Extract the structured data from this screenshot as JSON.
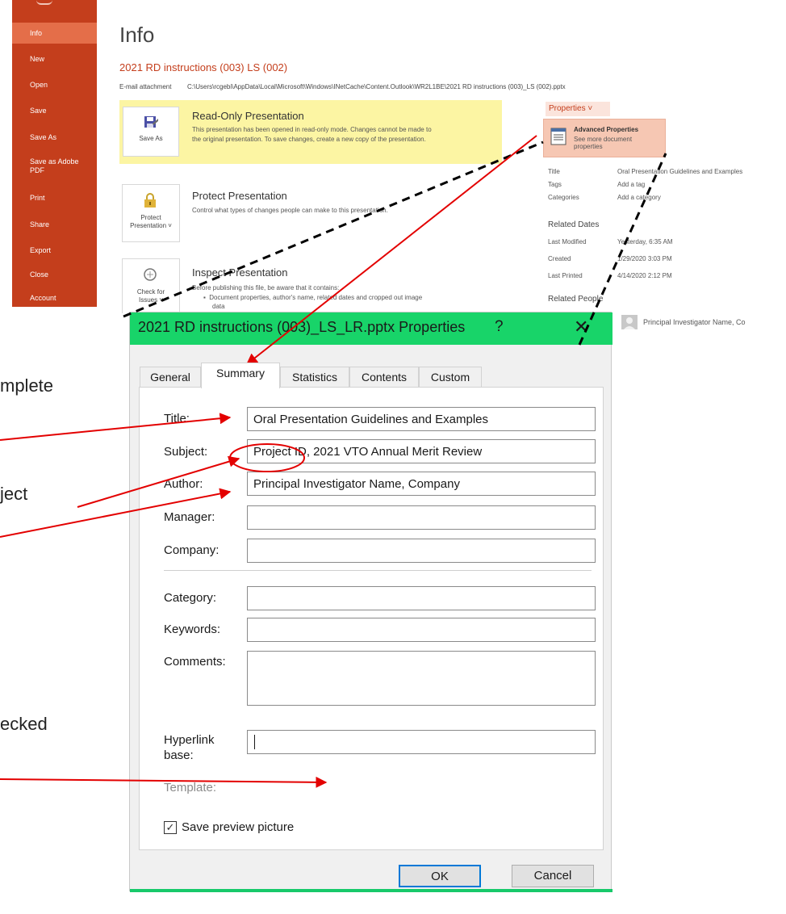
{
  "backstage": {
    "items": [
      {
        "label": "Info",
        "active": true
      },
      {
        "label": "New"
      },
      {
        "label": "Open"
      },
      {
        "label": "Save"
      },
      {
        "label": "Save As"
      },
      {
        "label": "Save as Adobe PDF"
      },
      {
        "label": "Print"
      },
      {
        "label": "Share"
      },
      {
        "label": "Export"
      },
      {
        "label": "Close"
      },
      {
        "label": "Account"
      }
    ]
  },
  "info": {
    "heading": "Info",
    "doc_title": "2021 RD instructions (003) LS (002)",
    "attachment_label": "E-mail attachment",
    "attachment_path": "C:\\Users\\rcgebi\\AppData\\Local\\Microsoft\\Windows\\INetCache\\Content.Outlook\\WR2L1BE\\2021 RD instructions (003)_LS (002).pptx",
    "readonly": {
      "button_label": "Save As",
      "title": "Read-Only Presentation",
      "desc_line1": "This presentation has been opened in read-only mode. Changes cannot be made to",
      "desc_line2": "the original presentation. To save changes, create a new copy of the presentation."
    },
    "protect": {
      "button_label_1": "Protect",
      "button_label_2": "Presentation ˅",
      "title": "Protect Presentation",
      "desc": "Control what types of changes people can make to this presentation."
    },
    "inspect": {
      "button_label_1": "Check for",
      "button_label_2": "Issues ˅",
      "title": "Inspect Presentation",
      "desc_line1": "Before publishing this file, be aware that it contains:",
      "desc_line2": "Document properties, author's name, related dates and cropped out image",
      "desc_line3": "data"
    },
    "properties": {
      "button_label": "Properties ˅",
      "advanced_title": "Advanced Properties",
      "advanced_desc": "See more document properties",
      "rows": [
        {
          "label": "Title",
          "value": "Oral Presentation Guidelines and Examples"
        },
        {
          "label": "Tags",
          "value": "Add a tag"
        },
        {
          "label": "Categories",
          "value": "Add a category"
        }
      ],
      "related_dates_heading": "Related Dates",
      "dates": [
        {
          "label": "Last Modified",
          "value": "Yesterday, 6:35 AM"
        },
        {
          "label": "Created",
          "value": "1/29/2020 3:03 PM"
        },
        {
          "label": "Last Printed",
          "value": "4/14/2020 2:12 PM"
        }
      ],
      "related_people_heading": "Related People",
      "author_name": "Principal Investigator Name, Co"
    }
  },
  "dialog": {
    "title": "2021 RD instructions (003)_LS_LR.pptx Properties",
    "help_label": "?",
    "close_label": "✕",
    "tabs": [
      "General",
      "Summary",
      "Statistics",
      "Contents",
      "Custom"
    ],
    "active_tab": "Summary",
    "fields": {
      "title_label": "Title:",
      "title_value": "Oral Presentation Guidelines and Examples",
      "subject_label": "Subject:",
      "subject_value": "Project ID, 2021 VTO Annual Merit Review",
      "author_label": "Author:",
      "author_value": "Principal Investigator Name, Company",
      "manager_label": "Manager:",
      "manager_value": "",
      "company_label": "Company:",
      "company_value": "",
      "category_label": "Category:",
      "category_value": "",
      "keywords_label": "Keywords:",
      "keywords_value": "",
      "comments_label": "Comments:",
      "comments_value": "",
      "hyperlink_label_1": "Hyperlink",
      "hyperlink_label_2": "base:",
      "hyperlink_value": "",
      "template_label": "Template:"
    },
    "save_preview": {
      "label": "Save preview picture",
      "checked": true
    },
    "ok_label": "OK",
    "cancel_label": "Cancel"
  },
  "clipped_text": {
    "line1": "mplete",
    "line2": "ject",
    "line3": "ecked"
  },
  "colors": {
    "backstage": "#c43e1c",
    "titlebar": "#18d469",
    "readonly_bg": "#fcf5a3",
    "arrow": "#e30000"
  }
}
